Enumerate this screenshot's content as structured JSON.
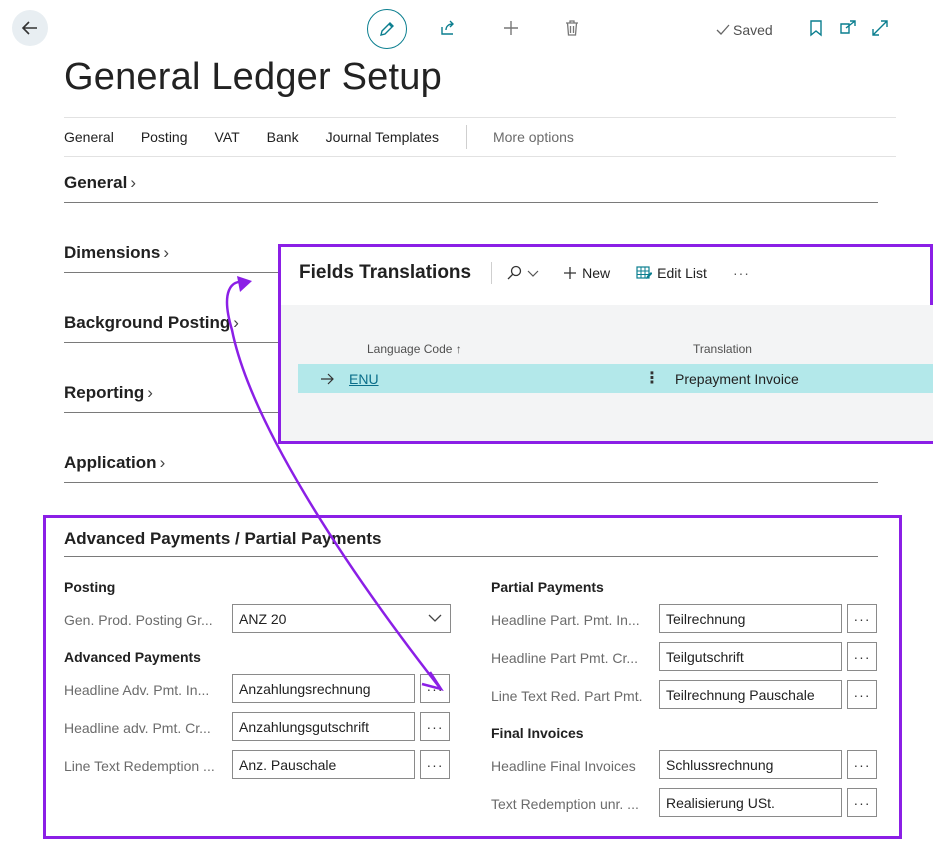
{
  "toolbar": {
    "back_icon": "arrow-left-icon",
    "edit_icon": "pencil-icon",
    "share_icon": "share-icon",
    "new_icon": "plus-icon",
    "delete_icon": "trash-icon",
    "saved_label": "Saved",
    "bookmark_icon": "bookmark-icon",
    "open_new_icon": "open-in-new-window-icon",
    "expand_icon": "expand-icon"
  },
  "page_title": "General Ledger Setup",
  "tabs": [
    "General",
    "Posting",
    "VAT",
    "Bank",
    "Journal Templates"
  ],
  "tabs_more": "More options",
  "sections": [
    "General",
    "Dimensions",
    "Background Posting",
    "Reporting",
    "Application"
  ],
  "fields_translations": {
    "title": "Fields Translations",
    "new_label": "New",
    "edit_list_label": "Edit List",
    "more": "···",
    "col_language": "Language Code",
    "col_translation": "Translation",
    "sort_arrow": "↑",
    "rows": [
      {
        "language": "ENU",
        "translation": "Prepayment Invoice"
      }
    ]
  },
  "advanced_payments": {
    "title": "Advanced Payments / Partial Payments",
    "posting_group": "Posting",
    "gen_prod_label": "Gen. Prod. Posting Gr...",
    "gen_prod_value": "ANZ 20",
    "adv_group": "Advanced Payments",
    "headline_adv_inv_label": "Headline Adv. Pmt. In...",
    "headline_adv_inv_value": "Anzahlungsrechnung",
    "headline_adv_cr_label": "Headline adv. Pmt. Cr...",
    "headline_adv_cr_value": "Anzahlungsgutschrift",
    "line_text_red_label": "Line Text Redemption ...",
    "line_text_red_value": "Anz. Pauschale",
    "partial_group": "Partial Payments",
    "headline_part_inv_label": "Headline Part. Pmt. In...",
    "headline_part_inv_value": "Teilrechnung",
    "headline_part_cr_label": "Headline Part Pmt. Cr...",
    "headline_part_cr_value": "Teilgutschrift",
    "line_text_red_part_label": "Line Text Red. Part Pmt.",
    "line_text_red_part_value": "Teilrechnung Pauschale",
    "final_group": "Final Invoices",
    "headline_final_label": "Headline Final Invoices",
    "headline_final_value": "Schlussrechnung",
    "text_red_unr_label": "Text Redemption unr. ...",
    "text_red_unr_value": "Realisierung USt.",
    "assist": "···"
  }
}
